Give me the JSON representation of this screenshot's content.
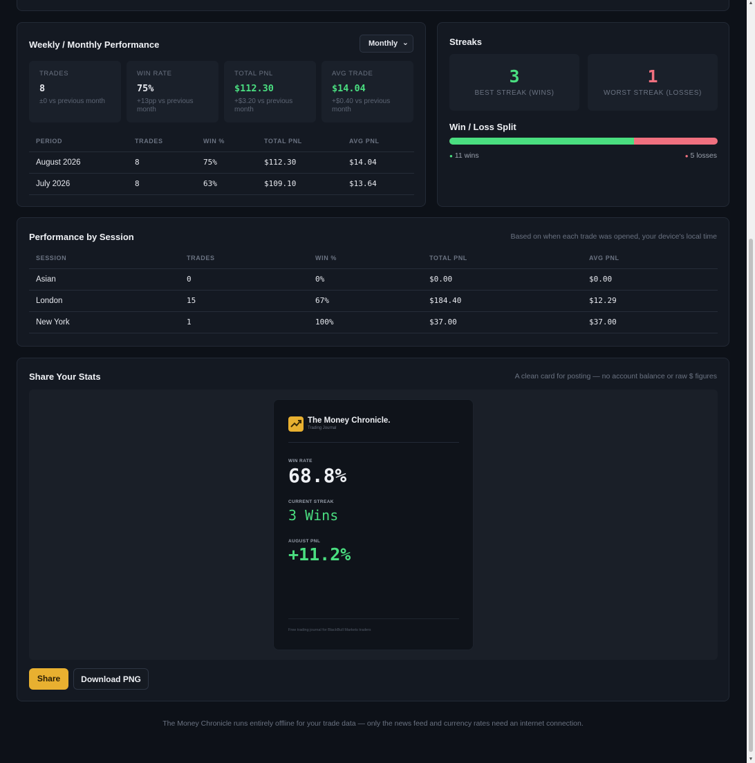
{
  "performance": {
    "title": "Weekly / Monthly Performance",
    "period_select": "Monthly",
    "stats": [
      {
        "label": "TRADES",
        "value": "8",
        "sub": "±0 vs previous month"
      },
      {
        "label": "WIN RATE",
        "value": "75%",
        "sub": "+13pp vs previous month"
      },
      {
        "label": "TOTAL PNL",
        "value": "$112.30",
        "sub": "+$3.20 vs previous month"
      },
      {
        "label": "AVG TRADE",
        "value": "$14.04",
        "sub": "+$0.40 vs previous month"
      }
    ],
    "columns": [
      "PERIOD",
      "TRADES",
      "WIN %",
      "TOTAL PNL",
      "AVG PNL"
    ],
    "rows": [
      {
        "period": "August 2026",
        "trades": "8",
        "win": "75%",
        "total": "$112.30",
        "avg": "$14.04"
      },
      {
        "period": "July 2026",
        "trades": "8",
        "win": "63%",
        "total": "$109.10",
        "avg": "$13.64"
      }
    ]
  },
  "streaks": {
    "title": "Streaks",
    "best_value": "3",
    "best_label": "BEST STREAK (WINS)",
    "worst_value": "1",
    "worst_label": "WORST STREAK (LOSSES)",
    "split_title": "Win / Loss Split",
    "win_fraction": 0.6875,
    "wins_label": "11 wins",
    "losses_label": "5 losses"
  },
  "session": {
    "title": "Performance by Session",
    "note": "Based on when each trade was opened, your device's local time",
    "columns": [
      "SESSION",
      "TRADES",
      "WIN %",
      "TOTAL PNL",
      "AVG PNL"
    ],
    "rows": [
      {
        "session": "Asian",
        "trades": "0",
        "win": "0%",
        "total": "$0.00",
        "avg": "$0.00"
      },
      {
        "session": "London",
        "trades": "15",
        "win": "67%",
        "total": "$184.40",
        "avg": "$12.29"
      },
      {
        "session": "New York",
        "trades": "1",
        "win": "100%",
        "total": "$37.00",
        "avg": "$37.00"
      }
    ]
  },
  "share": {
    "title": "Share Your Stats",
    "note": "A clean card for posting — no account balance or raw $ figures",
    "card": {
      "brand": "The Money Chronicle.",
      "brand_sub": "Trading Journal",
      "win_rate_label": "WIN RATE",
      "win_rate": "68.8%",
      "streak_label": "CURRENT STREAK",
      "streak": "3 Wins",
      "pnl_label": "AUGUST PNL",
      "pnl": "+11.2%",
      "footer": "Free trading journal for BlackBull Markets traders"
    },
    "share_button": "Share",
    "download_button": "Download PNG"
  },
  "footer": "The Money Chronicle runs entirely offline for your trade data — only the news feed and currency rates need an internet connection.",
  "colors": {
    "accent": "#e8b030",
    "positive": "#4ade80",
    "negative": "#f0707f"
  }
}
